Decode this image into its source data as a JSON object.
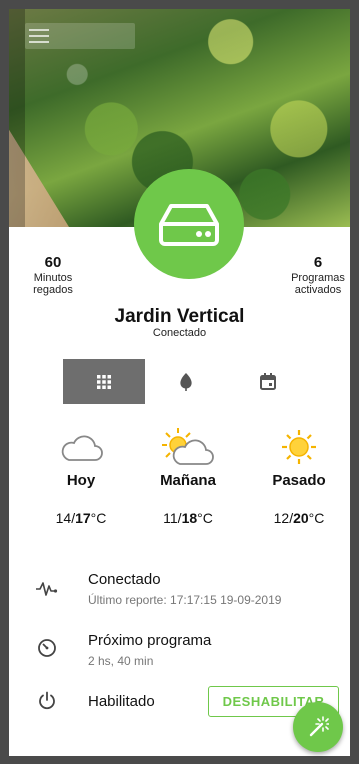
{
  "device": {
    "name": "Jardin Vertical",
    "status": "Conectado",
    "icon": "server-icon"
  },
  "stats": {
    "left": {
      "value": "60",
      "label_line1": "Minutos",
      "label_line2": "regados"
    },
    "right": {
      "value": "6",
      "label_line1": "Programas",
      "label_line2": "activados"
    }
  },
  "tabs": [
    {
      "name": "grid-icon",
      "active": true
    },
    {
      "name": "leaf-icon",
      "active": false
    },
    {
      "name": "calendar-icon",
      "active": false
    }
  ],
  "weather": [
    {
      "day": "Hoy",
      "min": "14",
      "max": "17",
      "unit": "°C",
      "icon": "cloud-icon"
    },
    {
      "day": "Mañana",
      "min": "11",
      "max": "18",
      "unit": "°C",
      "icon": "partly-sunny-icon"
    },
    {
      "day": "Pasado",
      "min": "12",
      "max": "20",
      "unit": "°C",
      "icon": "sun-icon"
    }
  ],
  "info": {
    "connection": {
      "title": "Conectado",
      "detail": "Último reporte: 17:17:15 19-09-2019"
    },
    "next_program": {
      "title": "Próximo programa",
      "detail": "2 hs, 40 min"
    },
    "enabled": {
      "title": "Habilitado",
      "action": "DESHABILITAR"
    }
  },
  "colors": {
    "accent": "#6fc84a",
    "tab_active": "#6e6e6e",
    "frame": "#4a4a4a"
  }
}
